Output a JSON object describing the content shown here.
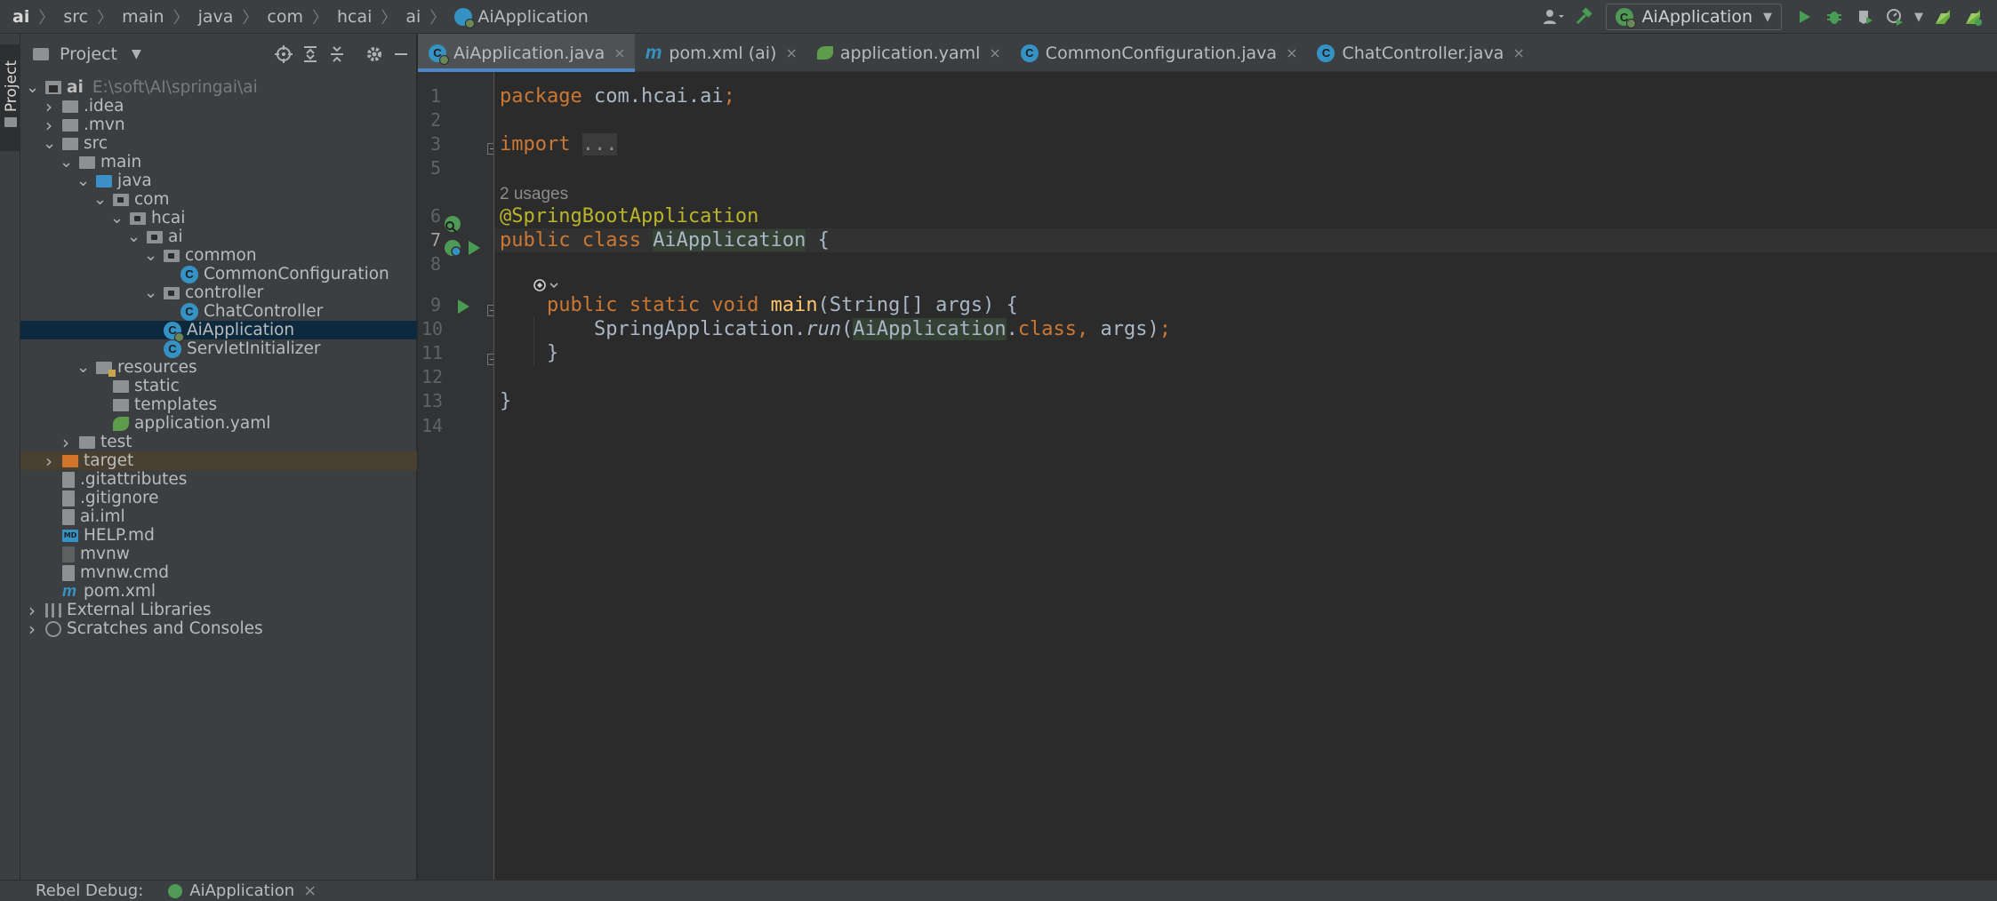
{
  "breadcrumb": [
    "ai",
    "src",
    "main",
    "java",
    "com",
    "hcai",
    "ai",
    "AiApplication"
  ],
  "toolbar": {
    "run_config": "AiApplication",
    "icons": [
      "user-icon",
      "build-hammer-icon",
      "run-icon",
      "debug-icon",
      "coverage-icon",
      "profile-icon",
      "jrebel-run-icon",
      "jrebel-debug-icon"
    ]
  },
  "side_stripe": {
    "label": "Project"
  },
  "project_panel": {
    "title": "Project",
    "header_icons": [
      "locate-icon",
      "expand-all-icon",
      "collapse-all-icon",
      "settings-icon",
      "hide-icon"
    ],
    "tree": [
      {
        "label": "ai",
        "extra": "E:\\soft\\AI\\springai\\ai",
        "depth": 0,
        "arrow": "open",
        "icon": "module",
        "bold": true
      },
      {
        "label": ".idea",
        "depth": 1,
        "arrow": "closed",
        "icon": "folder"
      },
      {
        "label": ".mvn",
        "depth": 1,
        "arrow": "closed",
        "icon": "folder"
      },
      {
        "label": "src",
        "depth": 1,
        "arrow": "open",
        "icon": "folder"
      },
      {
        "label": "main",
        "depth": 2,
        "arrow": "open",
        "icon": "folder"
      },
      {
        "label": "java",
        "depth": 3,
        "arrow": "open",
        "icon": "folder-blue"
      },
      {
        "label": "com",
        "depth": 4,
        "arrow": "open",
        "icon": "package"
      },
      {
        "label": "hcai",
        "depth": 5,
        "arrow": "open",
        "icon": "package"
      },
      {
        "label": "ai",
        "depth": 6,
        "arrow": "open",
        "icon": "package"
      },
      {
        "label": "common",
        "depth": 7,
        "arrow": "open",
        "icon": "package"
      },
      {
        "label": "CommonConfiguration",
        "depth": 8,
        "arrow": "none",
        "icon": "class"
      },
      {
        "label": "controller",
        "depth": 7,
        "arrow": "open",
        "icon": "package"
      },
      {
        "label": "ChatController",
        "depth": 8,
        "arrow": "none",
        "icon": "class"
      },
      {
        "label": "AiApplication",
        "depth": 7,
        "arrow": "none",
        "icon": "spring-class",
        "selected": true
      },
      {
        "label": "ServletInitializer",
        "depth": 7,
        "arrow": "none",
        "icon": "class"
      },
      {
        "label": "resources",
        "depth": 3,
        "arrow": "open",
        "icon": "resources"
      },
      {
        "label": "static",
        "depth": 4,
        "arrow": "none",
        "icon": "folder"
      },
      {
        "label": "templates",
        "depth": 4,
        "arrow": "none",
        "icon": "folder"
      },
      {
        "label": "application.yaml",
        "depth": 4,
        "arrow": "none",
        "icon": "yaml"
      },
      {
        "label": "test",
        "depth": 2,
        "arrow": "closed",
        "icon": "folder"
      },
      {
        "label": "target",
        "depth": 1,
        "arrow": "closed",
        "icon": "folder-orange",
        "excluded": true
      },
      {
        "label": ".gitattributes",
        "depth": 1,
        "arrow": "none",
        "icon": "file"
      },
      {
        "label": ".gitignore",
        "depth": 1,
        "arrow": "none",
        "icon": "file"
      },
      {
        "label": "ai.iml",
        "depth": 1,
        "arrow": "none",
        "icon": "file"
      },
      {
        "label": "HELP.md",
        "depth": 1,
        "arrow": "none",
        "icon": "md"
      },
      {
        "label": "mvnw",
        "depth": 1,
        "arrow": "none",
        "icon": "terminal"
      },
      {
        "label": "mvnw.cmd",
        "depth": 1,
        "arrow": "none",
        "icon": "file"
      },
      {
        "label": "pom.xml",
        "depth": 1,
        "arrow": "none",
        "icon": "maven"
      },
      {
        "label": "External Libraries",
        "depth": 0,
        "arrow": "closed",
        "icon": "library"
      },
      {
        "label": "Scratches and Consoles",
        "depth": 0,
        "arrow": "closed",
        "icon": "scratch"
      }
    ]
  },
  "tabs": [
    {
      "label": "AiApplication.java",
      "icon": "spring-class",
      "active": true
    },
    {
      "label": "pom.xml (ai)",
      "icon": "maven"
    },
    {
      "label": "application.yaml",
      "icon": "yaml"
    },
    {
      "label": "CommonConfiguration.java",
      "icon": "class"
    },
    {
      "label": "ChatController.java",
      "icon": "class"
    }
  ],
  "editor": {
    "usages_hint": "2 usages",
    "lines": [
      {
        "no": "1",
        "tokens": [
          [
            "kw",
            "package "
          ],
          [
            "",
            "com.hcai.ai"
          ],
          [
            "kw",
            ";"
          ]
        ]
      },
      {
        "no": "2",
        "tokens": []
      },
      {
        "no": "3",
        "tokens": [
          [
            "kw",
            "import "
          ],
          [
            "fold-box",
            "..."
          ]
        ]
      },
      {
        "no": "5",
        "tokens": []
      },
      {
        "no": "6",
        "tokens": [
          [
            "ann",
            "@SpringBootApplication"
          ]
        ]
      },
      {
        "no": "7",
        "tokens": [
          [
            "kw",
            "public class "
          ],
          [
            "hl",
            "AiApplication"
          ],
          [
            "",
            " {"
          ]
        ],
        "current": true
      },
      {
        "no": "8",
        "tokens": []
      },
      {
        "no": "9",
        "tokens": [
          [
            "",
            "    "
          ],
          [
            "kw",
            "public static void "
          ],
          [
            "fn",
            "main"
          ],
          [
            "",
            "(String[] args) {"
          ]
        ]
      },
      {
        "no": "10",
        "tokens": [
          [
            "",
            "        SpringApplication."
          ],
          [
            "it",
            "run"
          ],
          [
            "",
            "("
          ],
          [
            "hl",
            "AiApplication"
          ],
          [
            "",
            "."
          ],
          [
            "kw",
            "class, "
          ],
          [
            "",
            "args)"
          ],
          [
            "kw",
            ";"
          ]
        ]
      },
      {
        "no": "11",
        "tokens": [
          [
            "",
            "    }"
          ]
        ]
      },
      {
        "no": "12",
        "tokens": []
      },
      {
        "no": "13",
        "tokens": [
          [
            "",
            "}"
          ]
        ]
      },
      {
        "no": "14",
        "tokens": []
      }
    ]
  },
  "bottom": {
    "label": "Rebel Debug:",
    "tab": "AiApplication",
    "close": "×"
  },
  "close_glyph": "×",
  "colors": {
    "background": "#2b2b2b",
    "panel": "#3c3f41",
    "keyword": "#cc7832",
    "annotation": "#bbb529",
    "function": "#ffc66d",
    "selection": "#0d293e",
    "accent": "#4a88c7"
  }
}
